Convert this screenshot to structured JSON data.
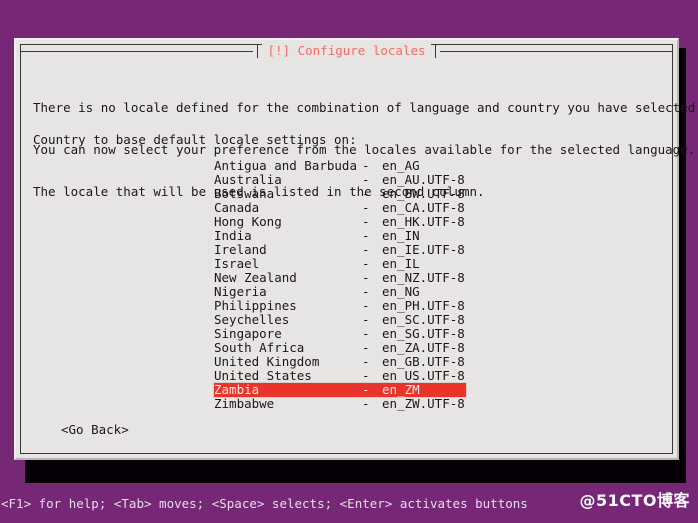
{
  "screen": {
    "background_color": "#762877",
    "shadow_color": "#060006"
  },
  "dialog": {
    "title": "[!] Configure locales",
    "title_color": "#f26d63",
    "background_color": "#e7e4e4",
    "border_color": "#3b3636",
    "paragraph": [
      "There is no locale defined for the combination of language and country you have selected.",
      "You can now select your preference from the locales available for the selected language.",
      "The locale that will be used is listed in the second column."
    ],
    "prompt": "Country to base default locale settings on:",
    "go_back_label": "<Go Back>",
    "selection_color": "#e8342a",
    "selection_text_color": "#f0eaea"
  },
  "locales": {
    "separator": "-",
    "selected_index": 16,
    "items": [
      {
        "country": "Antigua and Barbuda",
        "code": "en_AG"
      },
      {
        "country": "Australia",
        "code": "en_AU.UTF-8"
      },
      {
        "country": "Botswana",
        "code": "en_BW.UTF-8"
      },
      {
        "country": "Canada",
        "code": "en_CA.UTF-8"
      },
      {
        "country": "Hong Kong",
        "code": "en_HK.UTF-8"
      },
      {
        "country": "India",
        "code": "en_IN"
      },
      {
        "country": "Ireland",
        "code": "en_IE.UTF-8"
      },
      {
        "country": "Israel",
        "code": "en_IL"
      },
      {
        "country": "New Zealand",
        "code": "en_NZ.UTF-8"
      },
      {
        "country": "Nigeria",
        "code": "en_NG"
      },
      {
        "country": "Philippines",
        "code": "en_PH.UTF-8"
      },
      {
        "country": "Seychelles",
        "code": "en_SC.UTF-8"
      },
      {
        "country": "Singapore",
        "code": "en_SG.UTF-8"
      },
      {
        "country": "South Africa",
        "code": "en_ZA.UTF-8"
      },
      {
        "country": "United Kingdom",
        "code": "en_GB.UTF-8"
      },
      {
        "country": "United States",
        "code": "en_US.UTF-8"
      },
      {
        "country": "Zambia",
        "code": "en_ZM"
      },
      {
        "country": "Zimbabwe",
        "code": "en_ZW.UTF-8"
      }
    ]
  },
  "statusbar": {
    "hint": "<F1> for help; <Tab> moves; <Space> selects; <Enter> activates buttons"
  },
  "watermark": {
    "text": "@51CTO博客"
  }
}
